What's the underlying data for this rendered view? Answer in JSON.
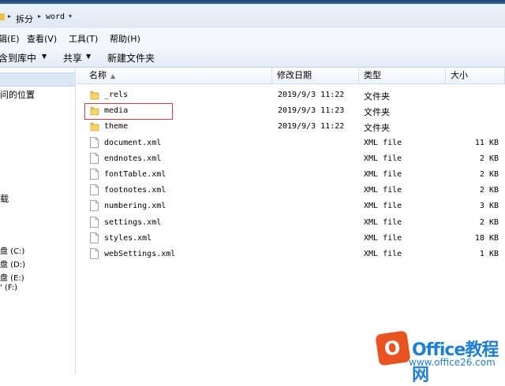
{
  "breadcrumb": {
    "folder": "拆分",
    "current": "word"
  },
  "menu": {
    "edit": "辑(E)",
    "view": "查看(V)",
    "tools": "工具(T)",
    "help": "帮助(H)"
  },
  "toolbar": {
    "include": "含到库中",
    "share": "共享",
    "new_folder": "新建文件夹"
  },
  "nav": {
    "recent": "问的位置",
    "downloads": "载",
    "drives": [
      "盘 (C:)",
      "盘 (D:)",
      "盘 (E:)",
      "' (F:)"
    ]
  },
  "columns": {
    "name": "名称",
    "date": "修改日期",
    "type": "类型",
    "size": "大小"
  },
  "files": [
    {
      "name": "_rels",
      "date": "2019/9/3 11:22",
      "type": "文件夹",
      "size": "",
      "icon": "folder-icon"
    },
    {
      "name": "media",
      "date": "2019/9/3 11:23",
      "type": "文件夹",
      "size": "",
      "icon": "folder-icon"
    },
    {
      "name": "theme",
      "date": "2019/9/3 11:22",
      "type": "文件夹",
      "size": "",
      "icon": "folder-icon"
    },
    {
      "name": "document.xml",
      "date": "",
      "type": "XML file",
      "size": "11 KB",
      "icon": "xml-file-icon"
    },
    {
      "name": "endnotes.xml",
      "date": "",
      "type": "XML file",
      "size": "2 KB",
      "icon": "xml-file-icon"
    },
    {
      "name": "fontTable.xml",
      "date": "",
      "type": "XML file",
      "size": "2 KB",
      "icon": "xml-file-icon"
    },
    {
      "name": "footnotes.xml",
      "date": "",
      "type": "XML file",
      "size": "2 KB",
      "icon": "xml-file-icon"
    },
    {
      "name": "numbering.xml",
      "date": "",
      "type": "XML file",
      "size": "3 KB",
      "icon": "xml-file-icon"
    },
    {
      "name": "settings.xml",
      "date": "",
      "type": "XML file",
      "size": "2 KB",
      "icon": "xml-file-icon"
    },
    {
      "name": "styles.xml",
      "date": "",
      "type": "XML file",
      "size": "18 KB",
      "icon": "xml-file-icon"
    },
    {
      "name": "webSettings.xml",
      "date": "",
      "type": "XML file",
      "size": "1 KB",
      "icon": "xml-file-icon"
    }
  ],
  "watermark": {
    "logo_letter": "O",
    "title": "Office教程网",
    "url": "www.office26.com"
  },
  "colors": {
    "highlight": "#e03b3b",
    "folder": "#e9c34a",
    "watermark_blue": "#1d7fd6",
    "watermark_orange": "#e8531f"
  }
}
